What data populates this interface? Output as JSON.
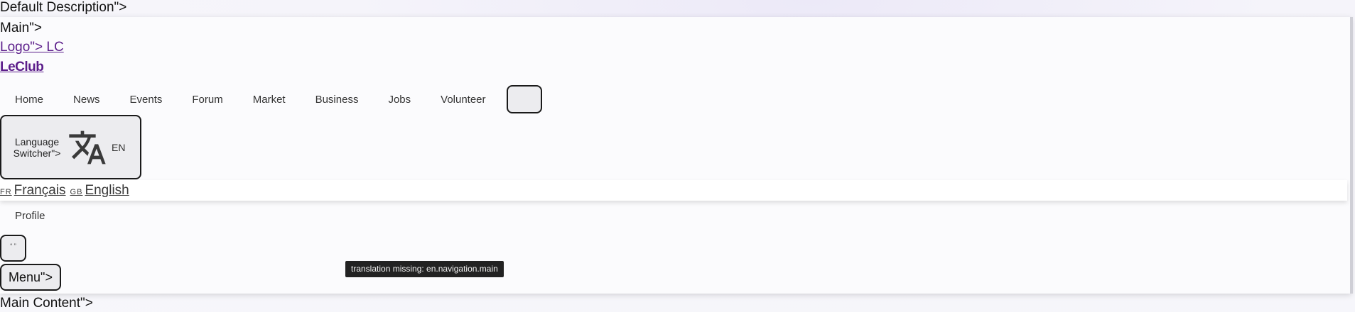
{
  "page": {
    "default_description_text": "Default Description\">",
    "main_text": "Main\">",
    "main_content_text": "Main Content\">"
  },
  "header": {
    "logo_link_text": "Logo\"> LC",
    "brand_link_text": "LeClub"
  },
  "nav": {
    "items": [
      {
        "label": "Home"
      },
      {
        "label": "News"
      },
      {
        "label": "Events"
      },
      {
        "label": "Forum"
      },
      {
        "label": "Market"
      },
      {
        "label": "Business"
      },
      {
        "label": "Jobs"
      },
      {
        "label": "Volunteer"
      }
    ],
    "profile_label": "Profile"
  },
  "language_switcher": {
    "label": "Language Switcher\">",
    "current_code": "EN",
    "icon": "translate-icon",
    "options": [
      {
        "flag": "FR",
        "label": "Français"
      },
      {
        "flag": "GB",
        "label": "English"
      }
    ]
  },
  "menu_button": {
    "label": "Menu\">"
  },
  "tooltip": {
    "text": "translation missing: en.navigation.main"
  }
}
